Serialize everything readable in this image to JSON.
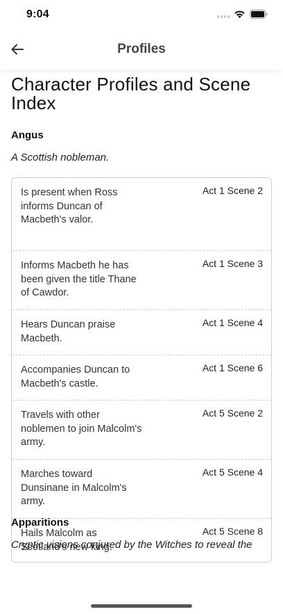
{
  "status_bar": {
    "time": "9:04"
  },
  "nav": {
    "title": "Profiles"
  },
  "page": {
    "title": "Character Profiles and Scene Index"
  },
  "character": {
    "name": "Angus",
    "description": "A Scottish nobleman.",
    "scenes": [
      {
        "text": "Is present when Ross informs Duncan of Macbeth's valor.",
        "ref": "Act 1 Scene 2"
      },
      {
        "text": "Informs Macbeth he has been given the title Thane of Cawdor.",
        "ref": "Act 1 Scene 3"
      },
      {
        "text": "Hears Duncan praise Macbeth.",
        "ref": "Act 1 Scene 4"
      },
      {
        "text": "Accompanies Duncan to Macbeth's castle.",
        "ref": "Act 1 Scene 6"
      },
      {
        "text": "Travels with other noblemen to join Malcolm's army.",
        "ref": "Act 5 Scene 2"
      },
      {
        "text": "Marches toward Dunsinane in Malcolm's army.",
        "ref": "Act 5 Scene 4"
      },
      {
        "text": "Hails Malcolm as Scotland's new king.",
        "ref": "Act 5 Scene 8"
      }
    ]
  },
  "next_section": {
    "name": "Apparitions",
    "description": "Cryptic visions conjured by the Witches to reveal the"
  },
  "icons": {
    "back": "arrow-left-icon",
    "signal": "cellular-signal-icon",
    "wifi": "wifi-icon",
    "battery": "battery-icon"
  }
}
